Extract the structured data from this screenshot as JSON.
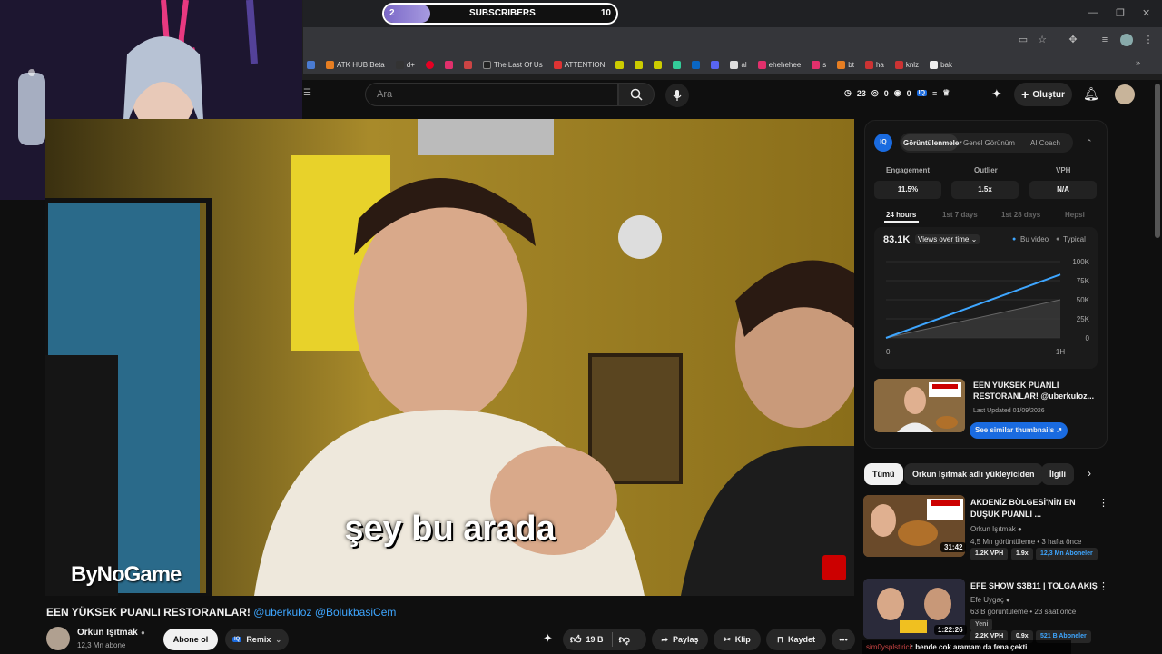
{
  "overlay": {
    "sub_current": "2",
    "sub_label": "SUBSCRIBERS",
    "sub_goal": "10",
    "sub_progress": 0.2
  },
  "bookmarks": [
    "ATK HUB Beta",
    "d+",
    "",
    "",
    "",
    "The Last Of Us",
    "ATTENTION",
    "",
    "",
    "",
    "",
    "",
    "al",
    "ehehehee",
    "s",
    "bt",
    "ha",
    "knlz",
    "bak"
  ],
  "header": {
    "search_placeholder": "Ara",
    "stat1": "23",
    "stat2": "0",
    "stat3": "0",
    "create_label": "Oluştur"
  },
  "video": {
    "subtitle": "şey bu arada",
    "watermark": "ByNoGame",
    "title_main": "EEN YÜKSEK PUANLI RESTORANLAR!",
    "title_tags": "@uberkuloz @BolukbasiCem",
    "channel": "Orkun Işıtmak",
    "subs": "12,3 Mn abone",
    "subscribe": "Abone ol",
    "remix": "Remix",
    "likes": "19 B",
    "share": "Paylaş",
    "clip": "Klip",
    "save": "Kaydet"
  },
  "panel": {
    "tabs": [
      "Görüntülenmeler",
      "Genel Görünüm",
      "AI Coach"
    ],
    "stats": [
      {
        "label": "Engagement",
        "value": "11.5%"
      },
      {
        "label": "Outlier",
        "value": "1.5x"
      },
      {
        "label": "VPH",
        "value": "N/A"
      }
    ],
    "ranges": [
      "24 hours",
      "1st 7 days",
      "1st 28 days",
      "Hepsi"
    ],
    "views": "83.1K",
    "views_mode": "Views over time",
    "legend_this": "Bu video",
    "legend_typical": "Typical",
    "yticks": [
      "100K",
      "75K",
      "50K",
      "25K",
      "0"
    ],
    "xticks": [
      "0",
      "1H"
    ],
    "thumb_title": "EEN YÜKSEK PUANLI RESTORANLAR! @uberkuloz...",
    "last_updated": "Last Updated 01/09/2026",
    "similar": "See similar thumbnails"
  },
  "chart_data": {
    "type": "area",
    "x": [
      0,
      1
    ],
    "series": [
      {
        "name": "Bu video",
        "values": [
          0,
          83100
        ]
      },
      {
        "name": "Typical",
        "values": [
          0,
          50000
        ]
      }
    ],
    "ylim": [
      0,
      100000
    ],
    "ylabel": "",
    "xlabel": ""
  },
  "chips": [
    "Tümü",
    "Orkun Işıtmak adlı yükleyiciden",
    "İlgili"
  ],
  "recs": [
    {
      "title1": "AKDENİZ BÖLGESİ'NİN EN",
      "title2": "DÜŞÜK PUANLI ...",
      "channel": "Orkun Işıtmak",
      "meta": "4,5 Mn görüntüleme • 3 hafta önce",
      "duration": "31:42",
      "vph": "1.2K VPH",
      "ratio": "1.9x",
      "subs": "12,3 Mn Aboneler",
      "tag": ""
    },
    {
      "title1": "EFE SHOW S3B11 | TOLGA AKIŞ",
      "title2": "",
      "channel": "Efe Uygaç",
      "meta": "63 B görüntüleme • 23 saat önce",
      "duration": "1:22:26",
      "vph": "2.2K VPH",
      "ratio": "0.9x",
      "subs": "521 B Aboneler",
      "tag": "Yeni"
    }
  ],
  "chat": {
    "user": "sim0ysplstirici",
    "message": ": bende cok aramam da fena çekti"
  },
  "colors": {
    "accent": "#3ea6ff",
    "bg": "#0f0f0f",
    "sub_fill": "#8f7fd6"
  }
}
